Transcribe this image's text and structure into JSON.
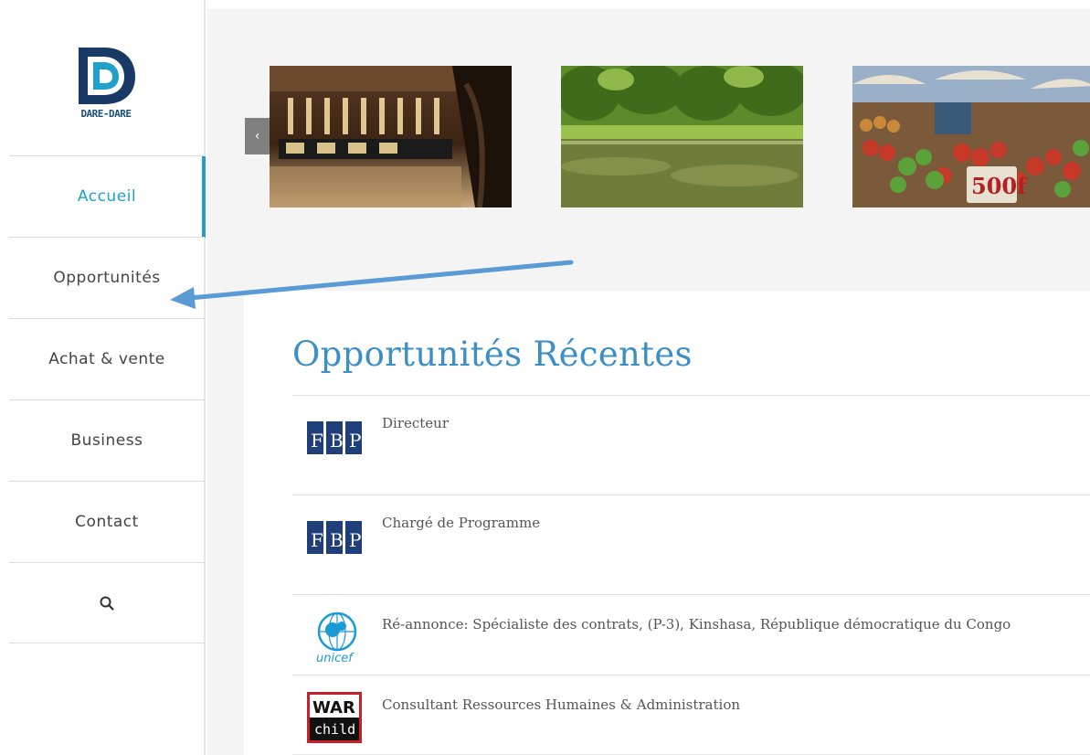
{
  "brand": {
    "name": "DARE-DARE",
    "colors": {
      "primary": "#1fa1c9",
      "title": "#3b8fc4",
      "logo_dark": "#1a4f7a"
    }
  },
  "sidebar": {
    "items": [
      {
        "label": "Accueil",
        "active": true
      },
      {
        "label": "Opportunités",
        "active": false
      },
      {
        "label": "Achat & vente",
        "active": false
      },
      {
        "label": "Business",
        "active": false
      },
      {
        "label": "Contact",
        "active": false
      }
    ],
    "search_icon": "search-icon"
  },
  "carousel": {
    "prev_icon": "chevron-left-icon",
    "slides": [
      {
        "name": "hotel-lobby-image"
      },
      {
        "name": "park-lake-image"
      },
      {
        "name": "market-vegetables-image"
      }
    ]
  },
  "main": {
    "section_title": "Opportunités Récentes",
    "opportunities": [
      {
        "logo": "FBP",
        "title": "Directeur"
      },
      {
        "logo": "FBP",
        "title": "Chargé de Programme"
      },
      {
        "logo": "unicef",
        "title": "Ré-annonce: Spécialiste des contrats, (P-3), Kinshasa, République démocratique du Congo"
      },
      {
        "logo_line1": "WAR",
        "logo_line2": "child",
        "title": "Consultant Ressources Humaines & Administration"
      }
    ]
  },
  "annotation": {
    "arrow_color": "#5b9bd5"
  }
}
